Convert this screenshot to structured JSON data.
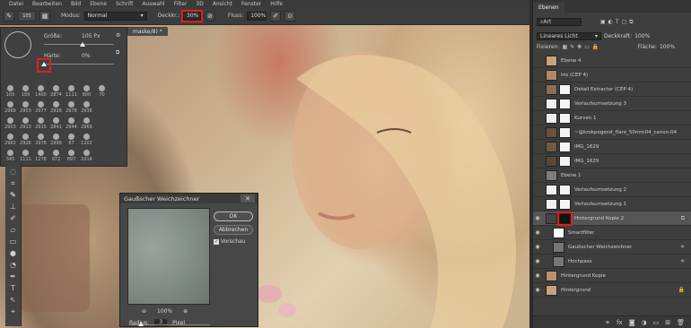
{
  "menubar": {
    "items": [
      "Datei",
      "Bearbeiten",
      "Bild",
      "Ebene",
      "Schrift",
      "Auswahl",
      "Filter",
      "3D",
      "Ansicht",
      "Fenster",
      "Hilfe"
    ]
  },
  "options": {
    "brush_size": "105",
    "mode_label": "Modus:",
    "mode_value": "Normal",
    "opacity_label": "Deckkr.:",
    "opacity_value": "30%",
    "flow_label": "Fluss:",
    "flow_value": "100%"
  },
  "doc_tab": {
    "label": "maske/8) *"
  },
  "brush_panel": {
    "size_label": "Größe:",
    "size_value": "105 Px",
    "hardness_label": "Härte:",
    "hardness_value": "0%",
    "size_fraction": 0.55,
    "hardness_fraction": 0.0,
    "presets": [
      "105",
      "199",
      "1400",
      "2874",
      "1111",
      "800",
      "70",
      "",
      "2989",
      "2953",
      "2977",
      "2928",
      "2978",
      "2936",
      "",
      "",
      "2953",
      "2913",
      "2915",
      "2841",
      "2944",
      "2969",
      "",
      "",
      "2962",
      "2926",
      "2978",
      "2999",
      "67",
      "1202",
      "",
      "",
      "345",
      "1111",
      "1278",
      "972",
      "897",
      "1014",
      "",
      ""
    ]
  },
  "gauss_dialog": {
    "title": "Gaußscher Weichzeichner",
    "ok_label": "OK",
    "cancel_label": "Abbrechen",
    "preview_label": "Vorschau",
    "preview_checked": true,
    "zoom_value": "100%",
    "radius_label": "Radius:",
    "radius_value": "3",
    "radius_unit": "Pixel"
  },
  "layers_panel": {
    "tab_label": "Ebenen",
    "filter_label": "Art",
    "blend_mode": "Lineares Licht",
    "opacity_label": "Deckkraft:",
    "opacity_value": "100%",
    "lock_label": "Fixieren:",
    "fill_label": "Fläche:",
    "fill_value": "100%",
    "layers": [
      {
        "name": "Ebene 4",
        "visible": false,
        "selected": false
      },
      {
        "name": "Iris (CEP 4)",
        "visible": false,
        "selected": false
      },
      {
        "name": "Detail Extractor (CEP 4)",
        "visible": false,
        "selected": false
      },
      {
        "name": "Verlaufsumsetzung 3",
        "visible": false,
        "selected": false
      },
      {
        "name": "Kurven 1",
        "visible": false,
        "selected": false
      },
      {
        "name": "~@krokpogerst_flare_50mm04_canon-04",
        "visible": false,
        "selected": false
      },
      {
        "name": "IMG_1629",
        "visible": false,
        "selected": false
      },
      {
        "name": "IMG_1629",
        "visible": false,
        "selected": false
      },
      {
        "name": "Ebene 1",
        "visible": false,
        "selected": false
      },
      {
        "name": "Verlaufsumsetzung 2",
        "visible": false,
        "selected": false
      },
      {
        "name": "Verlaufsumsetzung 1",
        "visible": false,
        "selected": false
      },
      {
        "name": "Hintergrund Kopie 2",
        "visible": true,
        "selected": true
      },
      {
        "name": "Smartfilter",
        "visible": true,
        "selected": false
      },
      {
        "name": "Gaußscher Weichzeichner",
        "visible": true,
        "selected": false
      },
      {
        "name": "Hochpass",
        "visible": true,
        "selected": false
      },
      {
        "name": "Hintergrund Kopie",
        "visible": true,
        "selected": false
      },
      {
        "name": "Hintergrund",
        "visible": true,
        "selected": false
      }
    ]
  }
}
